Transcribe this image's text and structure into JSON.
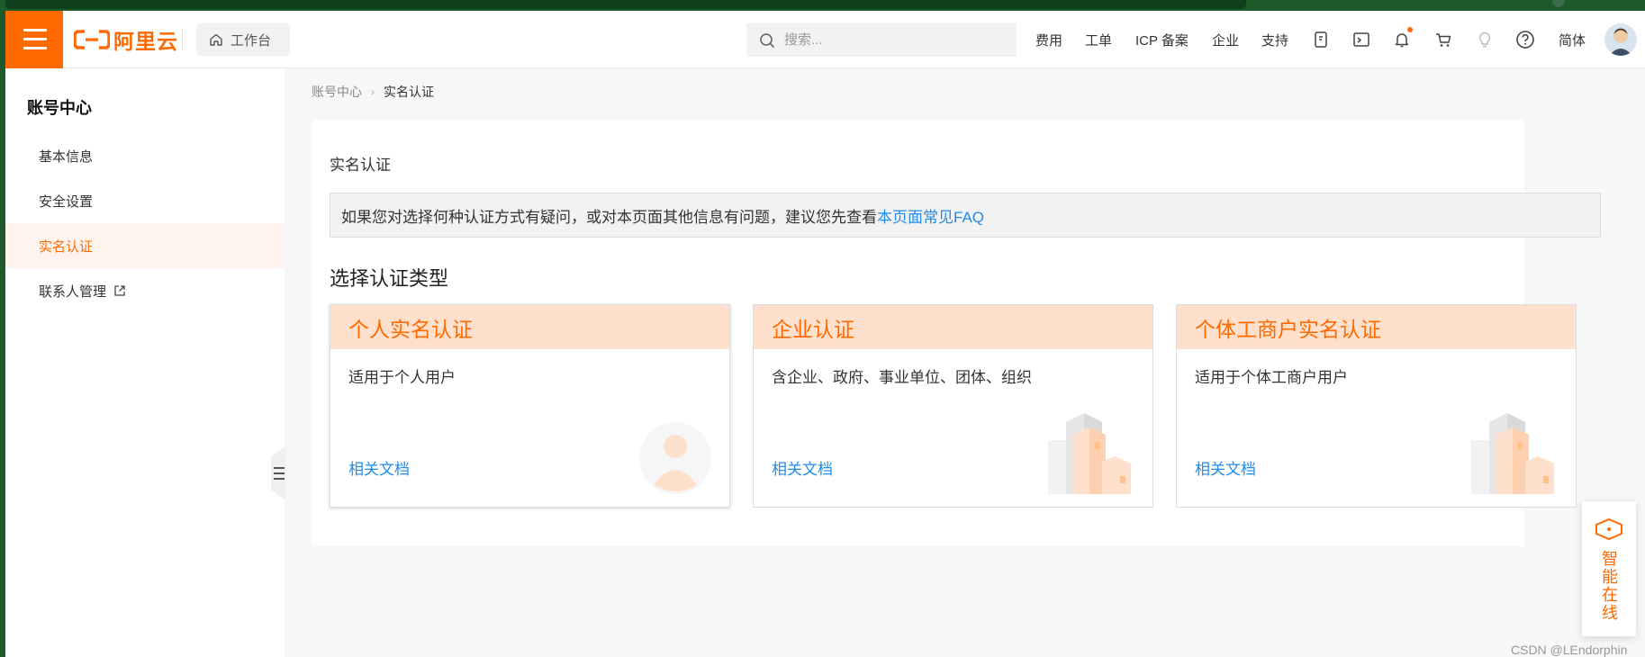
{
  "header": {
    "logo_text": "阿里云",
    "workbench_label": "工作台",
    "search_placeholder": "搜索...",
    "links": [
      "费用",
      "工单",
      "ICP 备案",
      "企业",
      "支持"
    ],
    "language": "简体",
    "accent": "#ff6a00"
  },
  "sidebar": {
    "title": "账号中心",
    "items": [
      {
        "label": "基本信息"
      },
      {
        "label": "安全设置"
      },
      {
        "label": "实名认证",
        "active": true
      },
      {
        "label": "联系人管理",
        "external": true
      }
    ]
  },
  "breadcrumb": [
    "账号中心",
    "实名认证"
  ],
  "main": {
    "panel_title": "实名认证",
    "notice_text": "如果您对选择何种认证方式有疑问，或对本页面其他信息有问题，建议您先查看",
    "notice_link": "本页面常见FAQ",
    "section_title": "选择认证类型",
    "cards": [
      {
        "title": "个人实名认证",
        "desc": "适用于个人用户",
        "link": "相关文档",
        "icon": "person-illustration"
      },
      {
        "title": "企业认证",
        "desc": "含企业、政府、事业单位、团体、组织",
        "link": "相关文档",
        "icon": "building-illustration"
      },
      {
        "title": "个体工商户实名认证",
        "desc": "适用于个体工商户用户",
        "link": "相关文档",
        "icon": "building-illustration"
      }
    ]
  },
  "assistant": {
    "label": "智能在线"
  },
  "watermark": "CSDN @LEndorphin"
}
